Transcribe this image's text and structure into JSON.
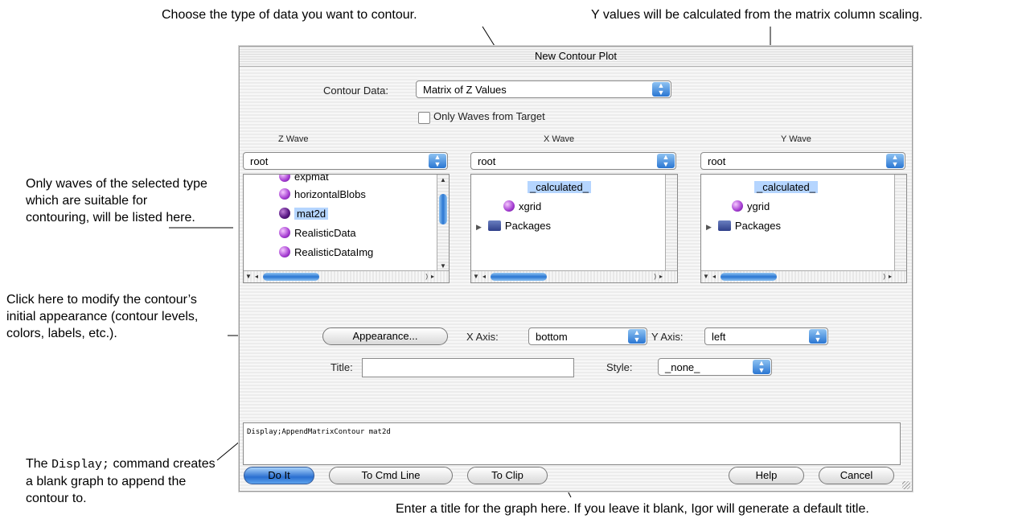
{
  "annotations": {
    "top_left": "Choose the type of data you want to contour.",
    "top_right": "Y values will be calculated from the matrix column scaling.",
    "left_1": "Only waves of the selected type which are suitable for contouring, will be listed here.",
    "left_2": "Click here to modify the contour’s initial appearance (contour levels, colors, labels, etc.).",
    "left_3_pre": "The ",
    "left_3_code": "Display;",
    "left_3_post": " command creates a blank graph to append the contour to.",
    "bottom": "Enter a title for the graph here. If you leave it blank, Igor will generate a default title."
  },
  "dialog": {
    "title": "New Contour Plot",
    "contour_data_label": "Contour Data:",
    "contour_data_value": "Matrix of Z Values",
    "only_waves_label": "Only Waves from Target",
    "only_waves_checked": false,
    "zwave": {
      "header": "Z Wave",
      "folder": "root",
      "items": [
        "expmat",
        "horizontalBlobs",
        "mat2d",
        "RealisticData",
        "RealisticDataImg"
      ],
      "selected": "mat2d"
    },
    "xwave": {
      "header": "X Wave",
      "folder": "root",
      "items": [
        "_calculated_",
        "xgrid",
        "Packages"
      ]
    },
    "ywave": {
      "header": "Y Wave",
      "folder": "root",
      "items": [
        "_calculated_",
        "ygrid",
        "Packages"
      ]
    },
    "appearance_button": "Appearance...",
    "xaxis_label": "X Axis:",
    "xaxis_value": "bottom",
    "yaxis_label": "Y Axis:",
    "yaxis_value": "left",
    "title_label": "Title:",
    "title_value": "",
    "style_label": "Style:",
    "style_value": "_none_",
    "command_text": "Display;AppendMatrixContour mat2d",
    "buttons": {
      "do_it": "Do It",
      "to_cmd_line": "To Cmd Line",
      "to_clip": "To Clip",
      "help": "Help",
      "cancel": "Cancel"
    }
  }
}
